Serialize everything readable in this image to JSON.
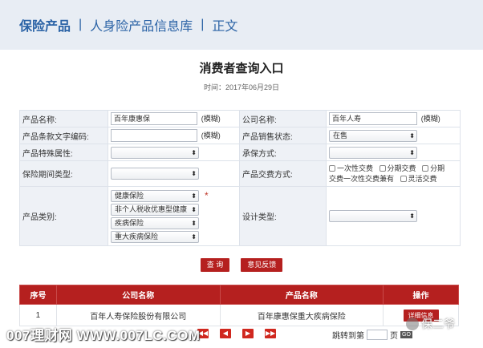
{
  "breadcrumb": {
    "items": [
      "保险产品",
      "人身险产品信息库",
      "正文"
    ],
    "separator": "|"
  },
  "page": {
    "title": "消费者查询入口",
    "time": "时间：2017年06月29日"
  },
  "form": {
    "product_name_label": "产品名称:",
    "product_name_value": "百年康惠保",
    "fuzzy": "(模糊)",
    "company_name_label": "公司名称:",
    "company_name_value": "百年人寿",
    "terms_code_label": "产品条款文字编码:",
    "terms_code_value": "",
    "sales_status_label": "产品销售状态:",
    "sales_status_value": "在售",
    "special_attr_label": "产品特殊属性:",
    "special_attr_value": "",
    "coverage_method_label": "承保方式:",
    "coverage_method_value": "",
    "period_type_label": "保险期间类型:",
    "period_type_value": "",
    "payment_method_label": "产品交费方式:",
    "payment_options": [
      "一次性交费",
      "分期交费",
      "分期",
      "交费一次性交费兼有",
      "灵活交费"
    ],
    "category_label": "产品类别:",
    "category_values": [
      "健康保险",
      "非个人税收优惠型健康",
      "疾病保险",
      "重大疾病保险"
    ],
    "required_mark": "*",
    "design_type_label": "设计类型:",
    "design_type_value": ""
  },
  "actions": {
    "search": "查 询",
    "feedback": "意见反馈"
  },
  "results": {
    "headers": [
      "序号",
      "公司名称",
      "产品名称",
      "操作"
    ],
    "rows": [
      {
        "index": "1",
        "company": "百年人寿保险股份有限公司",
        "product": "百年康惠保重大疾病保险",
        "action": "详细信息"
      }
    ]
  },
  "pagination": {
    "first": "◀◀",
    "prev": "◀",
    "next": "▶",
    "last": "▶▶",
    "jump_label": "跳转到第",
    "page_unit": "页",
    "go": "GO"
  },
  "watermarks": {
    "left": "007理财网 WWW.007LC.COM",
    "right": "保二爷"
  },
  "colors": {
    "brand_red": "#b5201f",
    "breadcrumb_blue": "#2b63a6",
    "label_bg": "#eef1f6"
  }
}
